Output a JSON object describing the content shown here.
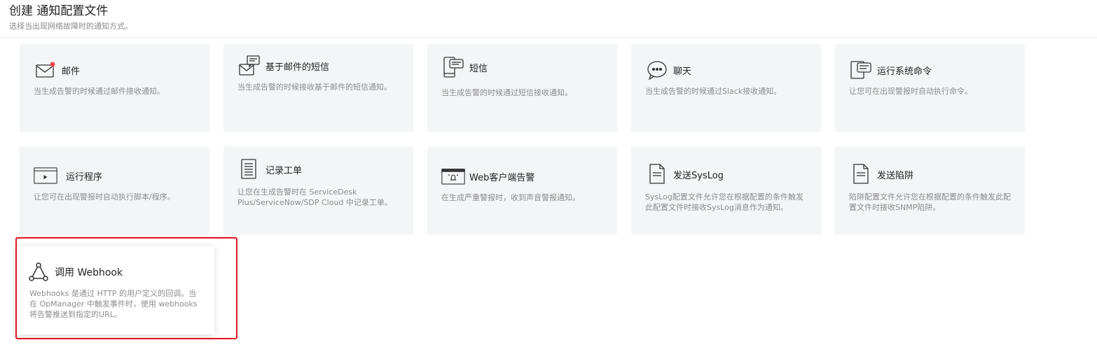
{
  "header": {
    "title": "创建 通知配置文件",
    "subtitle": "选择当出现网络故障时的通知方式。"
  },
  "colors": {
    "card_bg": "#f4f5f7",
    "highlight": "#e0141e",
    "notification_dot": "#f04a4a"
  },
  "cards": [
    {
      "title": "邮件",
      "desc": "当生成告警的时候通过邮件接收通知。",
      "icon": "mail-icon"
    },
    {
      "title": "基于邮件的短信",
      "desc": "当生成告警的时候接收基于邮件的短信通知。",
      "icon": "mail-sms-icon"
    },
    {
      "title": "短信",
      "desc": "当生成告警的时候通过短信接收通知。",
      "icon": "sms-phone-icon"
    },
    {
      "title": "聊天",
      "desc": "当生成告警的时候通过Slack接收通知。",
      "icon": "chat-icon"
    },
    {
      "title": "运行系统命令",
      "desc": "让您可在出现警报时自动执行命令。",
      "icon": "command-icon"
    },
    {
      "title": "运行程序",
      "desc": "让您可在出现警报时自动执行脚本/程序。",
      "icon": "run-program-icon"
    },
    {
      "title": "记录工单",
      "desc": "让您在生成告警时在 ServiceDesk Plus/ServiceNow/SDP Cloud 中记录工单。",
      "icon": "ticket-icon"
    },
    {
      "title": "Web客户端告警",
      "desc": "在生成严重警报时，收到声音警报通知。",
      "icon": "web-alarm-icon"
    },
    {
      "title": "发送SysLog",
      "desc": "SysLog配置文件允许您在根据配置的条件触发此配置文件时接收SysLog消息作为通知。",
      "icon": "syslog-document-icon"
    },
    {
      "title": "发送陷阱",
      "desc": "陷阱配置文件允许您在根据配置的条件触发此配置文件时接收SNMP陷阱。",
      "icon": "trap-document-icon"
    },
    {
      "title": "调用 Webhook",
      "desc": "Webhooks 是通过 HTTP 的用户定义的回调。当在 OpManager 中触发事件时，使用 webhooks将告警推送到指定的URL。",
      "icon": "webhook-icon"
    }
  ]
}
